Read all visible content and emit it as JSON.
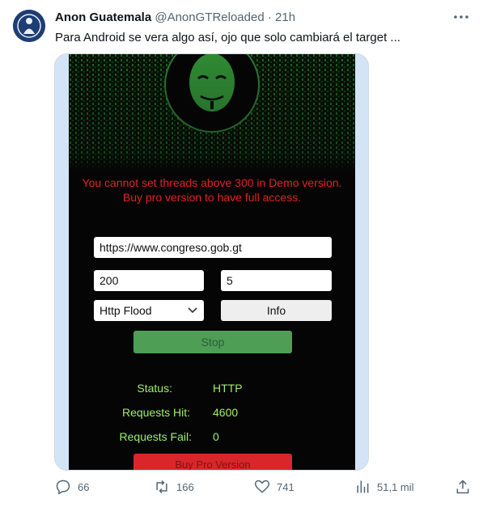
{
  "tweet": {
    "author_name": "Anon Guatemala",
    "handle": "@AnonGTReloaded",
    "separator": "·",
    "time": "21h",
    "text": "Para Android se vera algo así, ojo que solo cambiará el target ..."
  },
  "app": {
    "warning_line1": "You cannot set threads above 300 in Demo version.",
    "warning_line2": "Buy pro version to have full access.",
    "url_value": "https://www.congreso.gob.gt",
    "threads_value": "200",
    "second_value": "5",
    "method_selected": "Http Flood",
    "info_label": "Info",
    "stop_label": "Stop",
    "status_label": "Status:",
    "status_value": "HTTP",
    "hits_label": "Requests Hit:",
    "hits_value": "4600",
    "fails_label": "Requests Fail:",
    "fails_value": "0",
    "buy_label": "Buy Pro Version",
    "accent_red": "#e22222",
    "accent_green": "#9ef06a"
  },
  "actions": {
    "replies": "66",
    "retweets": "166",
    "likes": "741",
    "views": "51,1 mil"
  }
}
